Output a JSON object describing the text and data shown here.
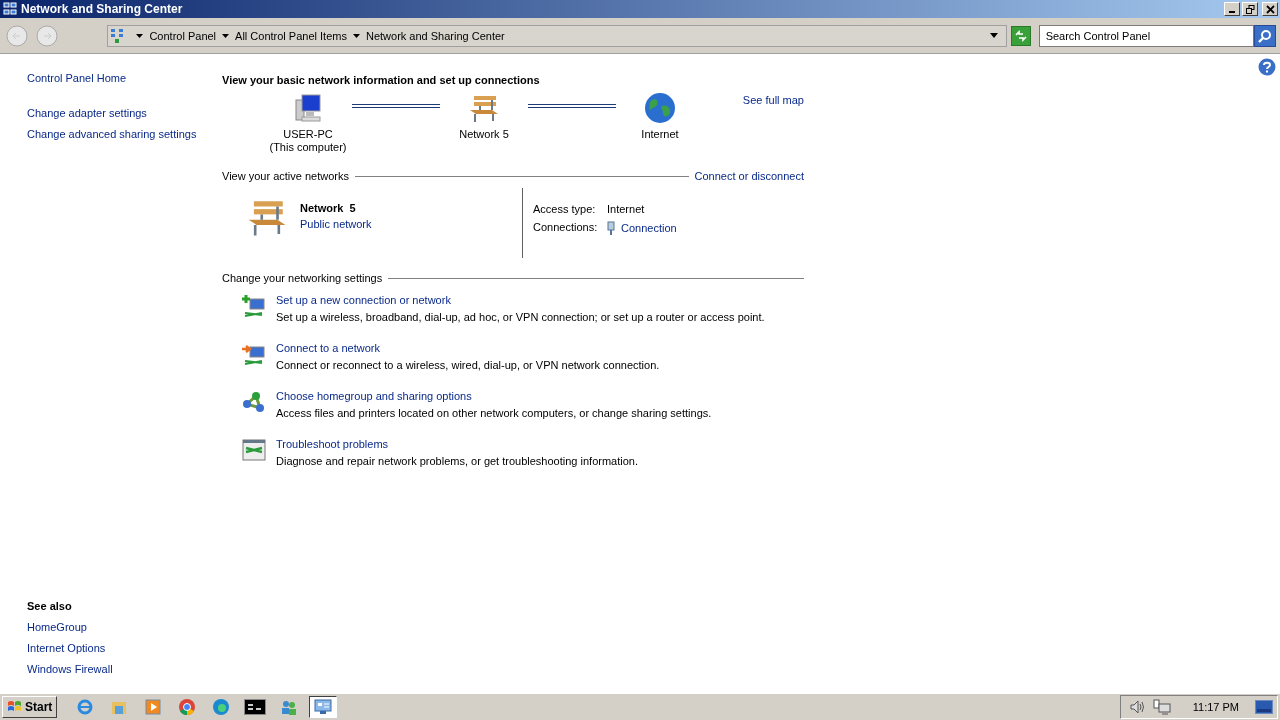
{
  "window": {
    "title": "Network and Sharing Center"
  },
  "address": {
    "crumbs": [
      "Control Panel",
      "All Control Panel Items",
      "Network and Sharing Center"
    ],
    "search_placeholder": "Search Control Panel"
  },
  "sidebar": {
    "links": [
      "Control Panel Home",
      "Change adapter settings",
      "Change advanced sharing settings"
    ],
    "see_also_title": "See also",
    "see_also": [
      "HomeGroup",
      "Internet Options",
      "Windows Firewall"
    ]
  },
  "main": {
    "heading": "View your basic network information and set up connections",
    "map_nodes": [
      {
        "kind": "computer",
        "label": "USER-PC",
        "sublabel": "(This computer)"
      },
      {
        "kind": "bench",
        "label": "Network  5"
      },
      {
        "kind": "globe",
        "label": "Internet"
      }
    ],
    "see_full_map": "See full map",
    "active_title": "View your active networks",
    "connect_link": "Connect or disconnect",
    "network": {
      "name": "Network  5",
      "type": "Public network",
      "access_label": "Access type:",
      "access_value": "Internet",
      "connections_label": "Connections:",
      "connections_value": "Connection"
    },
    "settings_title": "Change your networking settings",
    "tasks": [
      {
        "kind": "new-connection",
        "title": "Set up a new connection or network",
        "description": "Set up a wireless, broadband, dial-up, ad hoc, or VPN connection; or set up a router or access point."
      },
      {
        "kind": "connect",
        "title": "Connect to a network",
        "description": "Connect or reconnect to a wireless, wired, dial-up, or VPN network connection."
      },
      {
        "kind": "homegroup",
        "title": "Choose homegroup and sharing options",
        "description": "Access files and printers located on other network computers, or change sharing settings."
      },
      {
        "kind": "troubleshoot",
        "title": "Troubleshoot problems",
        "description": "Diagnose and repair network problems, or get troubleshooting information."
      }
    ]
  },
  "taskbar": {
    "start": "Start",
    "apps": [
      {
        "kind": "ie",
        "selected": false
      },
      {
        "kind": "explorer",
        "selected": false
      },
      {
        "kind": "media",
        "selected": false
      },
      {
        "kind": "chrome",
        "selected": false
      },
      {
        "kind": "edge",
        "selected": false
      },
      {
        "kind": "cmd",
        "selected": false
      },
      {
        "kind": "people",
        "selected": false
      },
      {
        "kind": "control",
        "selected": true
      }
    ],
    "clock": "11:17 PM"
  }
}
